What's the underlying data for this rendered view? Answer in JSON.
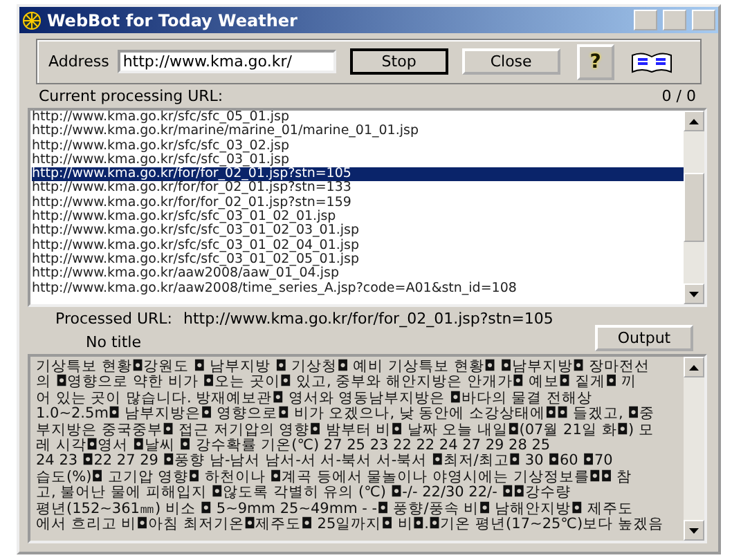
{
  "window": {
    "title": "WebBot for Today Weather"
  },
  "address": {
    "label": "Address",
    "value": "http://www.kma.go.kr/"
  },
  "buttons": [
    {
      "label": "Stop",
      "kind": "pressed"
    },
    {
      "label": "Close",
      "kind": "normal"
    },
    {
      "label": "?",
      "kind": "help"
    }
  ],
  "status": {
    "label": "Current processing URL:",
    "count": "0 / 0"
  },
  "url_list": [
    {
      "text": "http://www.kma.go.kr/sfc/sfc_05_01.jsp",
      "selected": false
    },
    {
      "text": "http://www.kma.go.kr/marine/marine_01/marine_01_01.jsp",
      "selected": false
    },
    {
      "text": "http://www.kma.go.kr/sfc/sfc_03_02.jsp",
      "selected": false
    },
    {
      "text": "http://www.kma.go.kr/sfc/sfc_03_01.jsp",
      "selected": false
    },
    {
      "text": "http://www.kma.go.kr/for/for_02_01.jsp?stn=105",
      "selected": true
    },
    {
      "text": "http://www.kma.go.kr/for/for_02_01.jsp?stn=133",
      "selected": false
    },
    {
      "text": "http://www.kma.go.kr/for/for_02_01.jsp?stn=159",
      "selected": false
    },
    {
      "text": "http://www.kma.go.kr/sfc/sfc_03_01_02_01.jsp",
      "selected": false
    },
    {
      "text": "http://www.kma.go.kr/sfc/sfc_03_01_02_03_01.jsp",
      "selected": false
    },
    {
      "text": "http://www.kma.go.kr/sfc/sfc_03_01_02_04_01.jsp",
      "selected": false
    },
    {
      "text": "http://www.kma.go.kr/sfc/sfc_03_01_02_05_01.jsp",
      "selected": false
    },
    {
      "text": "http://www.kma.go.kr/aaw2008/aaw_01_04.jsp",
      "selected": false
    },
    {
      "text": "http://www.kma.go.kr/aaw2008/time_series_A.jsp?code=A01&stn_id=108",
      "selected": false
    }
  ],
  "processed": {
    "label": "Processed URL:",
    "url": "http://www.kma.go.kr/for/for_02_01.jsp?stn=105",
    "title": "No title",
    "button": "Output"
  },
  "output_lines": [
    "기상특보 현황◘강원도 ◘ 남부지방 ◘ 기상청◘ 예비 기상특보 현황◘ ◘남부지방◘ 장마전선",
    "의 ◘영향으로 약한 비가 ◘오는 곳이◘ 있고, 중부와 해안지방은 안개가◘ 예보◘ 짙게◘ 끼",
    "어 있는 곳이 많습니다. 방재예보관◘ 영서와 영동남부지방은 ◘바다의 물결 전해상",
    "1.0~2.5m◘ 남부지방은◘ 영향으로◘ 비가 오겠으나, 낮 동안에 소강상태에◘◘ 들겠고, ◘중",
    "부지방은 중국중부◘ 접근 저기압의 영향◘ 밤부터 비◘ 날짜 오늘 내일◘(07월 21일 화◘) 모",
    "레 시각◘영서 ◘날씨 ◘ 강수확률 기온(℃) 27 25 23 22 22 24 27 29 28 25",
    "24 23 ◘22 27 29 ◘풍향 남-남서 남서-서 서-북서 서-북서 ◘최저/최고◘ 30 ◘60 ◘70",
    "습도(%)◘ 고기압 영향◘ 하천이나 ◘계곡 등에서 물놀이나 야영시에는 기상정보를◘◘ 참",
    "고, 불어난 물에 피해입지 ◘않도록 각별히 유의 (℃) ◘-/- 22/30 22/- ◘◘강수량",
    "평년(152~361㎜) 비소 ◘ 5~9mm 25~49mm - -◘ 풍향/풍속 비◘ 남해안지방◘ 제주도",
    "에서 흐리고 비◘아침 최저기온◘제주도◘ 25일까지◘ 비◘.◘기온 평년(17~25℃)보다 높겠음"
  ]
}
